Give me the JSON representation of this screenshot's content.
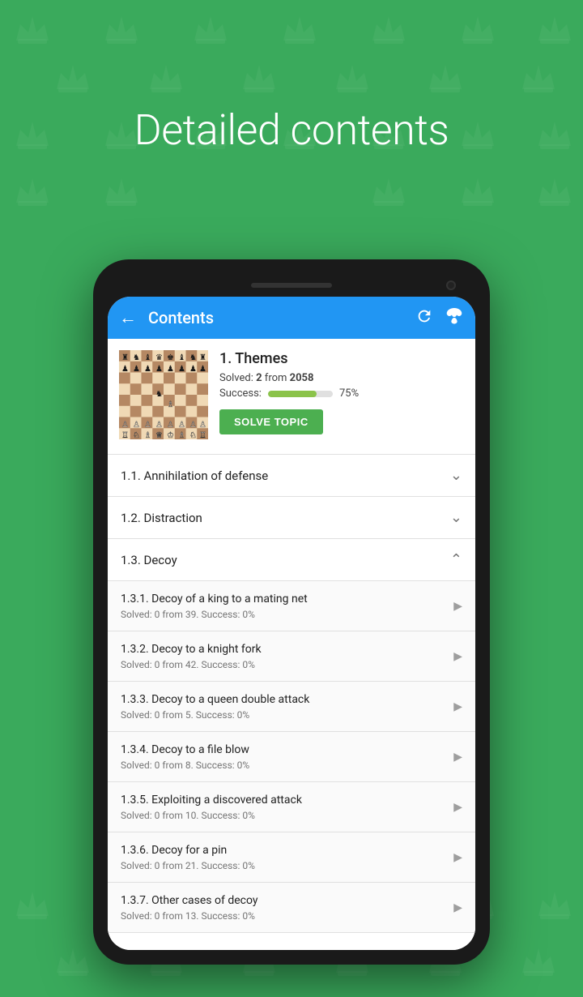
{
  "page": {
    "background_color": "#3aaa5c",
    "title": "Detailed contents"
  },
  "appbar": {
    "back_label": "←",
    "title": "Contents",
    "refresh_icon": "↻",
    "butterfly_icon": "✿"
  },
  "topic_card": {
    "title": "1. Themes",
    "solved_prefix": "Solved: ",
    "solved_count": "2",
    "solved_from": " from ",
    "solved_total": "2058",
    "success_label": "Success: ",
    "success_percent": "75%",
    "progress_fill_width": "75",
    "solve_button": "SOLVE TOPIC"
  },
  "sections": [
    {
      "id": "1.1",
      "title": "1.1. Annihilation of defense",
      "expanded": false,
      "items": []
    },
    {
      "id": "1.2",
      "title": "1.2. Distraction",
      "expanded": false,
      "items": []
    },
    {
      "id": "1.3",
      "title": "1.3. Decoy",
      "expanded": true,
      "items": [
        {
          "title": "1.3.1. Decoy of a king to a mating net",
          "subtitle": "Solved: 0 from 39. Success: 0%"
        },
        {
          "title": "1.3.2. Decoy to a knight fork",
          "subtitle": "Solved: 0 from 42. Success: 0%"
        },
        {
          "title": "1.3.3. Decoy to a queen double attack",
          "subtitle": "Solved: 0 from 5. Success: 0%"
        },
        {
          "title": "1.3.4. Decoy to a file blow",
          "subtitle": "Solved: 0 from 8. Success: 0%"
        },
        {
          "title": "1.3.5. Exploiting a discovered attack",
          "subtitle": "Solved: 0 from 10. Success: 0%"
        },
        {
          "title": "1.3.6. Decoy for a pin",
          "subtitle": "Solved: 0 from 21. Success: 0%"
        },
        {
          "title": "1.3.7. Other cases of decoy",
          "subtitle": "Solved: 0 from 13. Success: 0%"
        }
      ]
    }
  ]
}
